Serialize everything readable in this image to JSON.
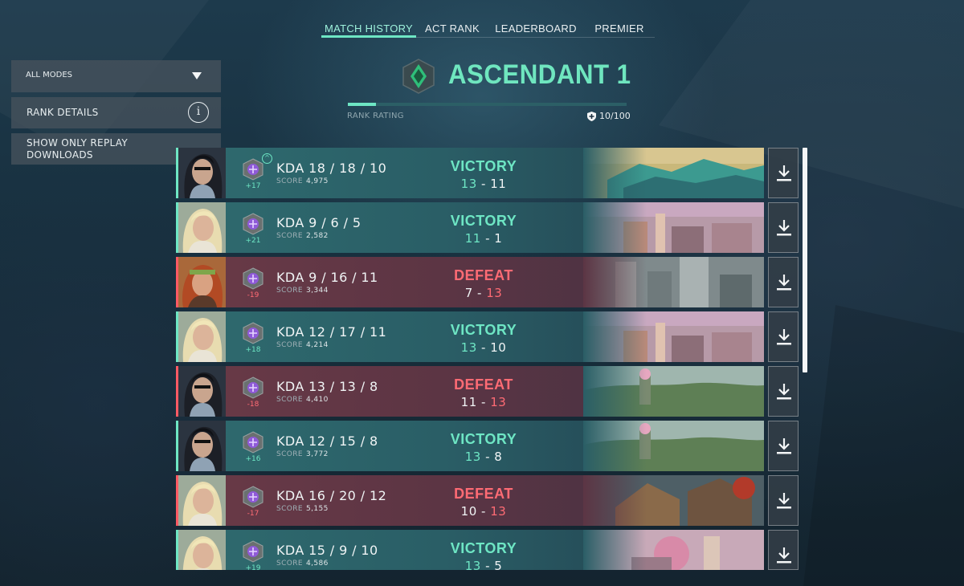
{
  "tabs": [
    {
      "label": "MATCH HISTORY"
    },
    {
      "label": "ACT RANK"
    },
    {
      "label": "LEADERBOARD"
    },
    {
      "label": "PREMIER"
    }
  ],
  "rank": {
    "title": "ASCENDANT 1",
    "rating_label": "RANK RATING",
    "rating_value": "10/100",
    "rating_fraction": 0.1,
    "accent": "#6ee6c4"
  },
  "sidebar": {
    "mode_select": "ALL MODES",
    "rank_details": "RANK DETAILS",
    "replay_toggle": "SHOW ONLY REPLAY DOWNLOADS"
  },
  "colors": {
    "victory": "#6ee6c4",
    "defeat": "#ff6b74"
  },
  "matches": [
    {
      "outcome": "win",
      "result": "VICTORY",
      "kda": "KDA 18 / 18 / 10",
      "score_label": "SCORE",
      "score": "4,975",
      "rr": "+17",
      "my_rounds": "13",
      "dash": "-",
      "their_rounds": "11",
      "agent_icon": "agent-dark-hair",
      "map_icon": "map-teal-roofs",
      "rank_up": true
    },
    {
      "outcome": "win",
      "result": "VICTORY",
      "kda": "KDA 9 / 6 / 5",
      "score_label": "SCORE",
      "score": "2,582",
      "rr": "+21",
      "my_rounds": "11",
      "dash": "-",
      "their_rounds": "1",
      "agent_icon": "agent-blonde",
      "map_icon": "map-city-pink",
      "rank_up": false
    },
    {
      "outcome": "loss",
      "result": "DEFEAT",
      "kda": "KDA 9 / 16 / 11",
      "score_label": "SCORE",
      "score": "3,344",
      "rr": "-19",
      "my_rounds": "7",
      "dash": "-",
      "their_rounds": "13",
      "agent_icon": "agent-red-hair",
      "map_icon": "map-towers-grey",
      "rank_up": false
    },
    {
      "outcome": "win",
      "result": "VICTORY",
      "kda": "KDA 12 / 17 / 11",
      "score_label": "SCORE",
      "score": "4,214",
      "rr": "+18",
      "my_rounds": "13",
      "dash": "-",
      "their_rounds": "10",
      "agent_icon": "agent-blonde",
      "map_icon": "map-city-pink",
      "rank_up": false
    },
    {
      "outcome": "loss",
      "result": "DEFEAT",
      "kda": "KDA 13 / 13 / 8",
      "score_label": "SCORE",
      "score": "4,410",
      "rr": "-18",
      "my_rounds": "11",
      "dash": "-",
      "their_rounds": "13",
      "agent_icon": "agent-dark-hair",
      "map_icon": "map-jungle-green",
      "rank_up": false
    },
    {
      "outcome": "win",
      "result": "VICTORY",
      "kda": "KDA 12 / 15 / 8",
      "score_label": "SCORE",
      "score": "3,772",
      "rr": "+16",
      "my_rounds": "13",
      "dash": "-",
      "their_rounds": "8",
      "agent_icon": "agent-dark-hair",
      "map_icon": "map-jungle-green",
      "rank_up": false
    },
    {
      "outcome": "loss",
      "result": "DEFEAT",
      "kda": "KDA 16 / 20 / 12",
      "score_label": "SCORE",
      "score": "5,155",
      "rr": "-17",
      "my_rounds": "10",
      "dash": "-",
      "their_rounds": "13",
      "agent_icon": "agent-blonde",
      "map_icon": "map-village-red",
      "rank_up": false
    },
    {
      "outcome": "win",
      "result": "VICTORY",
      "kda": "KDA 15 / 9 / 10",
      "score_label": "SCORE",
      "score": "4,586",
      "rr": "+19",
      "my_rounds": "13",
      "dash": "-",
      "their_rounds": "5",
      "agent_icon": "agent-blonde",
      "map_icon": "map-garden-pink",
      "rank_up": false
    }
  ]
}
